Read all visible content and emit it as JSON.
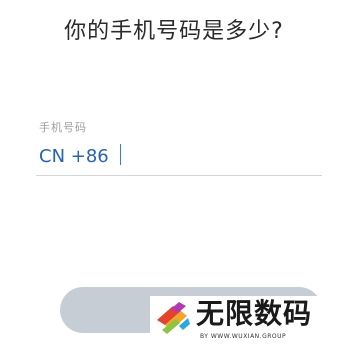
{
  "title": "你的手机号码是多少?",
  "phone_field": {
    "label": "手机号码",
    "value": "CN +86"
  },
  "watermark": {
    "name": "无限数码",
    "url_text": "BY WWW.WUXIAN.GROUP"
  },
  "colors": {
    "title_text": "#2b2b2b",
    "label_text": "#9aa0a6",
    "value_text": "#2563b8",
    "caret": "#2b7de9",
    "button_disabled": "#c7cdd4"
  },
  "icons": {
    "watermark_logo": "wuxian-logo-icon"
  }
}
